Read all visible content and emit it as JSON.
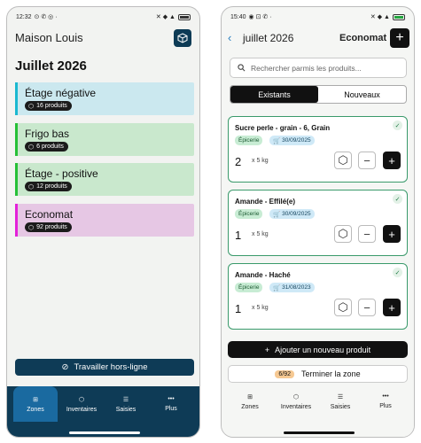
{
  "left": {
    "status": {
      "time": "12:32"
    },
    "app_title": "Maison Louis",
    "month": "Juillet 2026",
    "zones": [
      {
        "name": "Étage négative",
        "badge": "16 produits",
        "bg": "#cbe8ef",
        "accent": "#1bb8d0"
      },
      {
        "name": "Frigo bas",
        "badge": "6 produits",
        "bg": "#c9e8cd",
        "accent": "#26c037"
      },
      {
        "name": "Étage - positive",
        "badge": "12 produits",
        "bg": "#c9e8cd",
        "accent": "#26c037"
      },
      {
        "name": "Economat",
        "badge": "92 produits",
        "bg": "#e6c7e4",
        "accent": "#e321d9"
      }
    ],
    "offline_label": "Travailler hors-ligne",
    "nav": [
      "Zones",
      "Inventaires",
      "Saisies",
      "Plus"
    ],
    "nav_active": "Zones",
    "colors": {
      "primary": "#0e3b56",
      "active_tab": "#1a6aa0"
    }
  },
  "right": {
    "status": {
      "time": "15:40"
    },
    "back_icon": "chevron-left-icon",
    "month": "juillet 2026",
    "zone_title": "Economat",
    "search_placeholder": "Rechercher parmis les produits...",
    "tabs": [
      "Existants",
      "Nouveaux"
    ],
    "active_tab": "Existants",
    "products": [
      {
        "name": "Sucre perle - grain - 6, Grain",
        "category": "Épicerie",
        "date": "30/09/2025",
        "qty": "2",
        "unit": "x 5 kg"
      },
      {
        "name": "Amande - Effilé(e)",
        "category": "Épicerie",
        "date": "30/09/2025",
        "qty": "1",
        "unit": "x 5 kg"
      },
      {
        "name": "Amande - Haché",
        "category": "Épicerie",
        "date": "31/08/2023",
        "qty": "1",
        "unit": "x 5 kg"
      }
    ],
    "add_product_label": "Ajouter un nouveau produit",
    "finish": {
      "progress": "6/92",
      "label": "Terminer la zone"
    },
    "nav": [
      "Zones",
      "Inventaires",
      "Saisies",
      "Plus"
    ]
  }
}
